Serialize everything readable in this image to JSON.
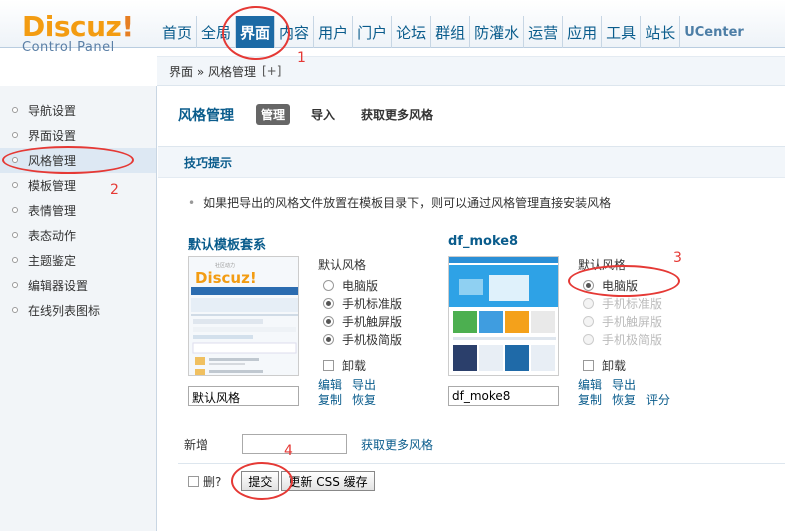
{
  "brand": {
    "logo_main": "Discuz",
    "logo_bang": "!",
    "logo_sub": "Control Panel"
  },
  "nav": [
    {
      "label": "首页"
    },
    {
      "label": "全局"
    },
    {
      "label": "界面"
    },
    {
      "label": "内容"
    },
    {
      "label": "用户"
    },
    {
      "label": "门户"
    },
    {
      "label": "论坛"
    },
    {
      "label": "群组"
    },
    {
      "label": "防灌水"
    },
    {
      "label": "运营"
    },
    {
      "label": "应用"
    },
    {
      "label": "工具"
    },
    {
      "label": "站长"
    },
    {
      "label": "UCenter"
    }
  ],
  "breadcrumb": {
    "text": "界面 » 风格管理",
    "add": "[+]"
  },
  "sidebar": {
    "items": [
      {
        "label": "导航设置"
      },
      {
        "label": "界面设置"
      },
      {
        "label": "风格管理"
      },
      {
        "label": "模板管理"
      },
      {
        "label": "表情管理"
      },
      {
        "label": "表态动作"
      },
      {
        "label": "主题鉴定"
      },
      {
        "label": "编辑器设置"
      },
      {
        "label": "在线列表图标"
      }
    ]
  },
  "main": {
    "title": "风格管理",
    "tabs": [
      {
        "label": "管理"
      },
      {
        "label": "导入"
      },
      {
        "label": "获取更多风格"
      }
    ],
    "tips_title": "技巧提示",
    "tip_text": "如果把导出的风格文件放置在模板目录下，则可以通过风格管理直接安装风格"
  },
  "themes": [
    {
      "name": "默认模板套系",
      "input_value": "默认风格",
      "default_caption": "默认风格",
      "options": [
        {
          "label": "电脑版",
          "checked": false,
          "disabled": false
        },
        {
          "label": "手机标准版",
          "checked": true,
          "disabled": false
        },
        {
          "label": "手机触屏版",
          "checked": true,
          "disabled": false
        },
        {
          "label": "手机极简版",
          "checked": true,
          "disabled": false
        }
      ],
      "uninstall_label": "卸载",
      "actions": [
        "编辑",
        "导出",
        "复制",
        "恢复"
      ],
      "thumb": {
        "logo": "Discuz!",
        "caption": "社区动力"
      }
    },
    {
      "name": "df_moke8",
      "input_value": "df_moke8",
      "default_caption": "默认风格",
      "options": [
        {
          "label": "电脑版",
          "checked": true,
          "disabled": false
        },
        {
          "label": "手机标准版",
          "checked": false,
          "disabled": true
        },
        {
          "label": "手机触屏版",
          "checked": false,
          "disabled": true
        },
        {
          "label": "手机极简版",
          "checked": false,
          "disabled": true
        }
      ],
      "uninstall_label": "卸载",
      "actions": [
        "编辑",
        "导出",
        "复制",
        "恢复",
        "评分"
      ]
    }
  ],
  "add_row": {
    "label": "新增",
    "link": "获取更多风格"
  },
  "footer": {
    "delete_label": "删?",
    "submit_label": "提交",
    "refresh_css_label": "更新 CSS 缓存"
  },
  "annotations": [
    "1",
    "2",
    "3",
    "4"
  ],
  "colors": {
    "accent": "#1c6aa5",
    "link": "#0a5c8c",
    "annotation": "#e53935",
    "brand": "#f39c12"
  }
}
